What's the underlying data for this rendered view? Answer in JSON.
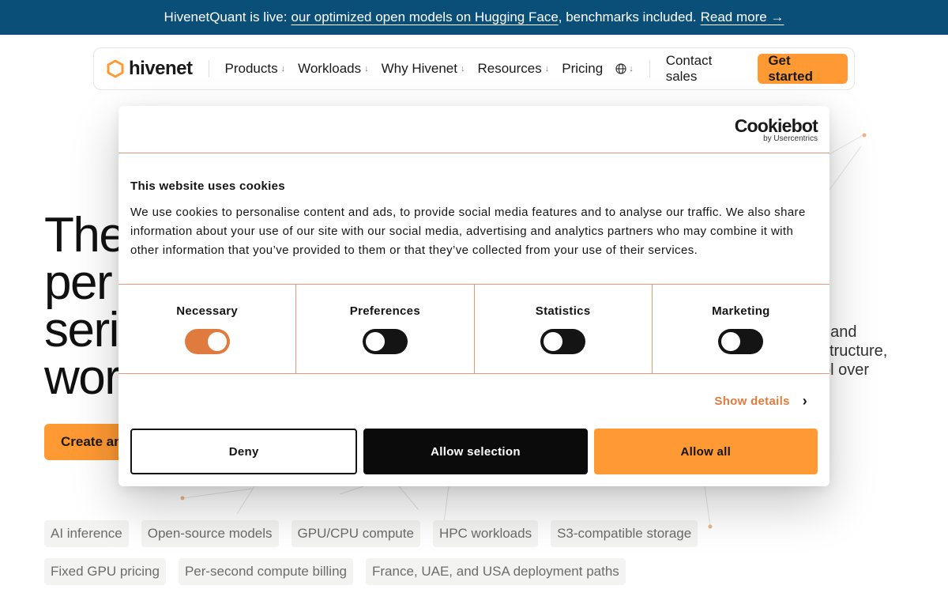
{
  "announcement": {
    "prefix": "HivenetQuant is live:",
    "link": "our optimized open models on Hugging Face",
    "middle": ", benchmarks included.",
    "read_more": "Read more →"
  },
  "nav": {
    "logo_text": "hivenet",
    "menu": [
      {
        "label": "Products",
        "has_dropdown": true
      },
      {
        "label": "Workloads",
        "has_dropdown": true
      },
      {
        "label": "Why Hivenet",
        "has_dropdown": true
      },
      {
        "label": "Resources",
        "has_dropdown": true
      },
      {
        "label": "Pricing",
        "has_dropdown": false
      }
    ],
    "language_icon": "globe-icon",
    "contact": "Contact sales",
    "cta": "Get started"
  },
  "hero": {
    "title_lines": [
      "The",
      "per",
      "seri",
      "wor"
    ],
    "subtitle_lines": [
      ", and",
      "structure,",
      "ol over"
    ],
    "primary_cta": "Create an"
  },
  "tags": {
    "row1": [
      "AI inference",
      "Open-source models",
      "GPU/CPU compute",
      "HPC workloads",
      "S3-compatible storage"
    ],
    "row2": [
      "Fixed GPU pricing",
      "Per-second compute billing",
      "France, UAE, and USA deployment paths"
    ]
  },
  "cookie": {
    "brand": "Cookiebot",
    "brand_by": "by Usercentrics",
    "title": "This website uses cookies",
    "text": "We use cookies to personalise content and ads, to provide social media features and to analyse our traffic. We also share information about your use of our site with our social media, advertising and analytics partners who may combine it with other information that you’ve provided to them or that they’ve collected from your use of their services.",
    "toggles": [
      {
        "label": "Necessary",
        "on": true
      },
      {
        "label": "Preferences",
        "on": false
      },
      {
        "label": "Statistics",
        "on": false
      },
      {
        "label": "Marketing",
        "on": false
      }
    ],
    "show_details": "Show details",
    "deny": "Deny",
    "allow_selection": "Allow selection",
    "allow_all": "Allow all"
  },
  "colors": {
    "announcement_bg": "#0a4f78",
    "accent": "#ff9933",
    "toggle_on": "#e07b3f",
    "divider": "#e2997a"
  }
}
